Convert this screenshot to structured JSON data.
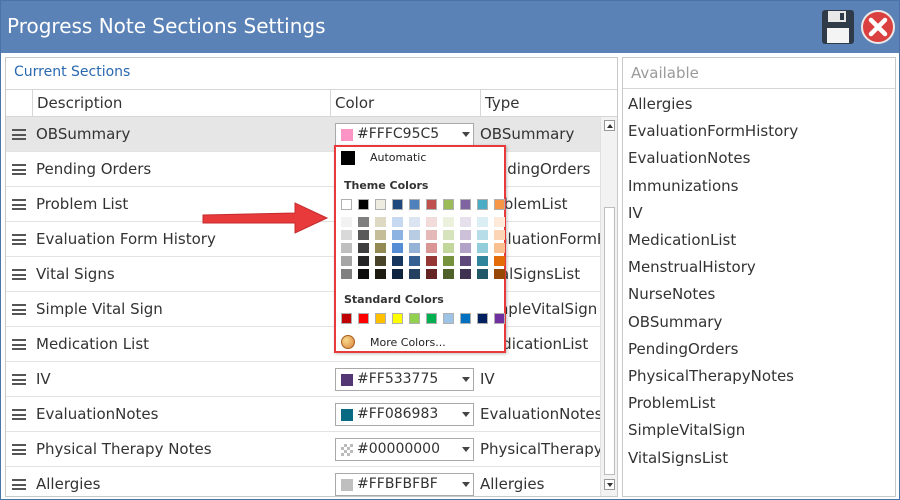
{
  "window": {
    "title": "Progress Note Sections Settings",
    "save_icon": "floppy-disk-icon",
    "close_icon": "close-icon"
  },
  "current": {
    "label": "Current Sections",
    "columns": {
      "description": "Description",
      "color": "Color",
      "type": "Type"
    },
    "rows": [
      {
        "description": "OBSummary",
        "color": "#FFFC95C5",
        "swatch": "#FC95C5",
        "type": "OBSummary",
        "selected": true
      },
      {
        "description": "Pending Orders",
        "color": "",
        "swatch": "",
        "type": "PendingOrders"
      },
      {
        "description": "Problem List",
        "color": "",
        "swatch": "",
        "type": "ProblemList"
      },
      {
        "description": "Evaluation Form History",
        "color": "",
        "swatch": "",
        "type": "EvaluationFormHistory"
      },
      {
        "description": "Vital Signs",
        "color": "",
        "swatch": "",
        "type": "VitalSignsList"
      },
      {
        "description": "Simple Vital Sign",
        "color": "",
        "swatch": "",
        "type": "SimpleVitalSign"
      },
      {
        "description": "Medication List",
        "color": "",
        "swatch": "",
        "type": "MedicationList"
      },
      {
        "description": "IV",
        "color": "#FF533775",
        "swatch": "#533775",
        "type": "IV"
      },
      {
        "description": "EvaluationNotes",
        "color": "#FF086983",
        "swatch": "#086983",
        "type": "EvaluationNotes"
      },
      {
        "description": "Physical Therapy Notes",
        "color": "#00000000",
        "swatch": "transparent",
        "type": "PhysicalTherapyNotes"
      },
      {
        "description": "Allergies",
        "color": "#FFBFBFBF",
        "swatch": "#BFBFBF",
        "type": "Allergies"
      }
    ]
  },
  "available": {
    "label": "Available",
    "items": [
      "Allergies",
      "EvaluationFormHistory",
      "EvaluationNotes",
      "Immunizations",
      "IV",
      "MedicationList",
      "MenstrualHistory",
      "NurseNotes",
      "OBSummary",
      "PendingOrders",
      "PhysicalTherapyNotes",
      "ProblemList",
      "SimpleVitalSign",
      "VitalSignsList"
    ]
  },
  "color_picker": {
    "automatic_label": "Automatic",
    "theme_label": "Theme Colors",
    "standard_label": "Standard Colors",
    "more_label": "More Colors...",
    "theme_colors": [
      "#FFFFFF",
      "#000000",
      "#EEECE1",
      "#1F497D",
      "#4F81BD",
      "#C0504D",
      "#9BBB59",
      "#8064A2",
      "#4BACC6",
      "#F79646"
    ],
    "theme_shades": [
      [
        "#F2F2F2",
        "#D9D9D9",
        "#BFBFBF",
        "#A6A6A6",
        "#808080"
      ],
      [
        "#7F7F7F",
        "#595959",
        "#404040",
        "#262626",
        "#0D0D0D"
      ],
      [
        "#DDD9C3",
        "#C4BD97",
        "#938953",
        "#494429",
        "#1D1B10"
      ],
      [
        "#C6D9F0",
        "#8DB3E2",
        "#548DD4",
        "#17365D",
        "#0F243E"
      ],
      [
        "#DBE5F1",
        "#B8CCE4",
        "#95B3D7",
        "#366092",
        "#244061"
      ],
      [
        "#F2DCDB",
        "#E5B9B7",
        "#D99694",
        "#953734",
        "#632423"
      ],
      [
        "#EBF1DD",
        "#D7E3BC",
        "#C3D69B",
        "#76923C",
        "#4F6128"
      ],
      [
        "#E5E0EC",
        "#CCC1D9",
        "#B2A2C7",
        "#5F497A",
        "#3F3151"
      ],
      [
        "#DBEEF3",
        "#B7DDE8",
        "#92CDDC",
        "#31859B",
        "#205867"
      ],
      [
        "#FDEADA",
        "#FBD5B5",
        "#FAC08F",
        "#E36C09",
        "#974806"
      ]
    ],
    "standard_colors": [
      "#C00000",
      "#FF0000",
      "#FFC000",
      "#FFFF00",
      "#92D050",
      "#00B050",
      "#9DC3E6",
      "#0070C0",
      "#002060",
      "#7030A0"
    ]
  },
  "annotation": {
    "arrow_color": "#E8393B",
    "arrow": "red-arrow-icon"
  }
}
